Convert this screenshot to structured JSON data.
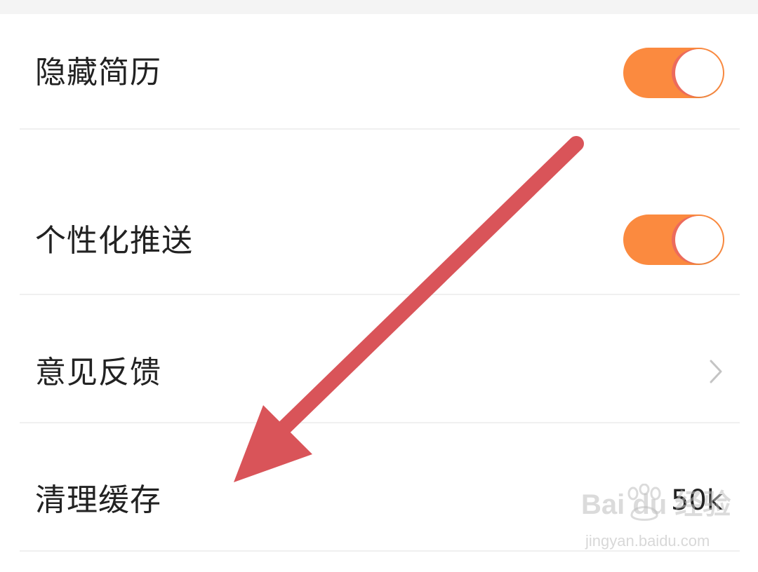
{
  "settings": {
    "items": [
      {
        "label": "隐藏简历",
        "control": "toggle",
        "on": true
      },
      {
        "label": "个性化推送",
        "control": "toggle",
        "on": true
      },
      {
        "label": "意见反馈",
        "control": "chevron-right-icon"
      },
      {
        "label": "清理缓存",
        "control": "value",
        "value": "50k"
      }
    ]
  },
  "annotation": {
    "arrow_color": "#d95459"
  },
  "colors": {
    "toggle_on": "#fb8a3f",
    "knob_ring": "#ec6b5c"
  },
  "watermark": {
    "logo_text": "Bai du 经验",
    "url": "jingyan.baidu.com"
  }
}
